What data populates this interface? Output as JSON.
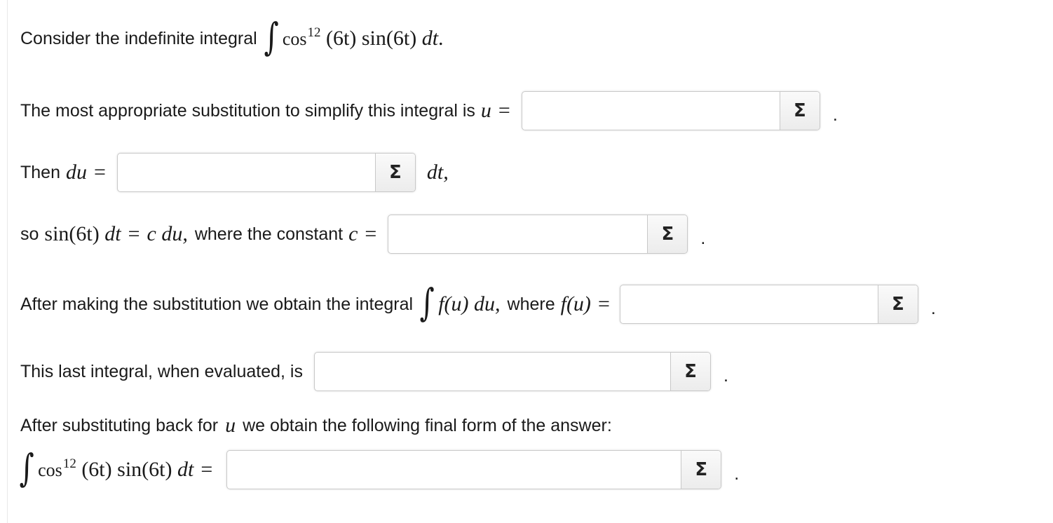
{
  "q1": {
    "text": "Consider the indefinite integral",
    "integral": "∫",
    "cos": "cos",
    "exponent": "12",
    "arg": "(6t)",
    "sin": "sin",
    "arg2": "(6t)",
    "dt": "dt",
    "end": "."
  },
  "q2": {
    "text": "The most appropriate substitution to simplify this integral is",
    "var": "u",
    "eq": "=",
    "sigma": "Σ",
    "end": ".",
    "value": ""
  },
  "q3": {
    "text": "Then",
    "var": "du",
    "eq": "=",
    "sigma": "Σ",
    "after": "dt,",
    "value": ""
  },
  "q4": {
    "text1": "so",
    "sin": "sin",
    "arg": "(6t)",
    "dt": "dt",
    "eq": "=",
    "cdu": "c du,",
    "text2": "where the constant",
    "var": "c",
    "eq2": "=",
    "sigma": "Σ",
    "end": ".",
    "value": ""
  },
  "q5": {
    "text1": "After making the substitution we obtain the integral",
    "integral": "∫",
    "fu": "f(u)",
    "du": "du,",
    "text2": "where",
    "fu2": "f(u)",
    "eq": "=",
    "sigma": "Σ",
    "end": ".",
    "value": ""
  },
  "q6": {
    "text": "This last integral, when evaluated, is",
    "sigma": "Σ",
    "end": ".",
    "value": ""
  },
  "q7": {
    "text1": "After substituting back for",
    "var": "u",
    "text2": "we obtain the following final form of the answer:",
    "integral": "∫",
    "cos": "cos",
    "exponent": "12",
    "arg": "(6t)",
    "sin": "sin",
    "arg2": "(6t)",
    "dt": "dt",
    "eq": "=",
    "sigma": "Σ",
    "end": ".",
    "value": ""
  }
}
